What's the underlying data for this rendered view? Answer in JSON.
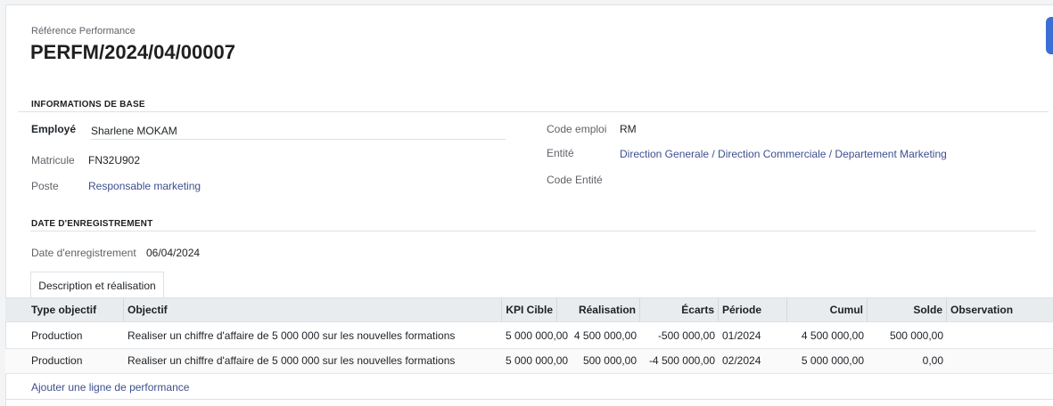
{
  "header": {
    "ref_label": "Référence Performance",
    "ref_value": "PERFM/2024/04/00007"
  },
  "base": {
    "title": "INFORMATIONS DE BASE",
    "employee_label": "Employé",
    "employee_value": "Sharlene MOKAM",
    "matricule_label": "Matricule",
    "matricule_value": "FN32U902",
    "poste_label": "Poste",
    "poste_value": "Responsable marketing",
    "code_emploi_label": "Code emploi",
    "code_emploi_value": "RM",
    "entite_label": "Entité",
    "entite_value": "Direction Generale / Direction Commerciale / Departement Marketing",
    "code_entite_label": "Code Entité"
  },
  "registration": {
    "title": "DATE D'ENREGISTREMENT",
    "date_label": "Date d'enregistrement",
    "date_value": "06/04/2024"
  },
  "tabs": [
    {
      "label": "Description et réalisation"
    }
  ],
  "table": {
    "columns": [
      "Type objectif",
      "Objectif",
      "KPI Cible",
      "Réalisation",
      "Écarts",
      "Période",
      "Cumul",
      "Solde",
      "Observation"
    ],
    "rows": [
      [
        "Production",
        "Realiser un chiffre d'affaire de 5 000 000 sur les nouvelles formations",
        "5 000 000,00",
        "4 500 000,00",
        "-500 000,00",
        "01/2024",
        "4 500 000,00",
        "500 000,00",
        ""
      ],
      [
        "Production",
        "Realiser un chiffre d'affaire de 5 000 000 sur les nouvelles formations",
        "5 000 000,00",
        "500 000,00",
        "-4 500 000,00",
        "02/2024",
        "5 000 000,00",
        "0,00",
        ""
      ]
    ],
    "add_line": "Ajouter une ligne de performance"
  },
  "colors": {
    "link": "#3f4f8f",
    "accent": "#3b6fd6",
    "header_bg": "#e9ecef"
  }
}
